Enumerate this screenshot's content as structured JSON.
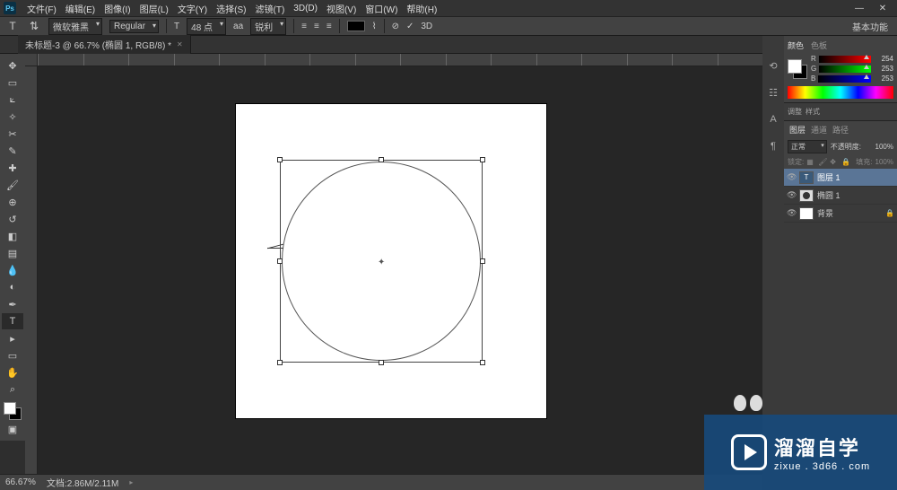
{
  "menu": {
    "items": [
      "文件(F)",
      "编辑(E)",
      "图像(I)",
      "图层(L)",
      "文字(Y)",
      "选择(S)",
      "滤镜(T)",
      "3D(D)",
      "视图(V)",
      "窗口(W)",
      "帮助(H)"
    ]
  },
  "options": {
    "font_family": "微软雅黑",
    "font_style": "Regular",
    "font_size": "48 点",
    "aa_label": "aa",
    "aa_mode": "锐利",
    "threed": "3D"
  },
  "workspace_switcher": "基本功能",
  "tab": {
    "title": "未标题-3 @ 66.7% (椭圆 1, RGB/8) *"
  },
  "color_panel": {
    "tab_color": "颜色",
    "tab_swatch": "色板",
    "r": {
      "label": "R",
      "value": "254"
    },
    "g": {
      "label": "G",
      "value": "253"
    },
    "b": {
      "label": "B",
      "value": "253"
    }
  },
  "adjust": {
    "tab1": "调整",
    "tab2": "样式"
  },
  "layers": {
    "tab_layers": "图层",
    "tab_channels": "通道",
    "tab_paths": "路径",
    "blend_mode": "正常",
    "opacity_label": "不透明度:",
    "opacity_value": "100%",
    "lock_label": "锁定:",
    "fill_label": "填充:",
    "fill_value": "100%",
    "rows": [
      {
        "name": "图层 1"
      },
      {
        "name": "椭圆 1"
      },
      {
        "name": "背景"
      }
    ]
  },
  "status": {
    "zoom": "66.67%",
    "doc": "文档:2.86M/2.11M"
  },
  "watermark": {
    "cn": "溜溜自学",
    "en": "zixue . 3d66 . com"
  }
}
